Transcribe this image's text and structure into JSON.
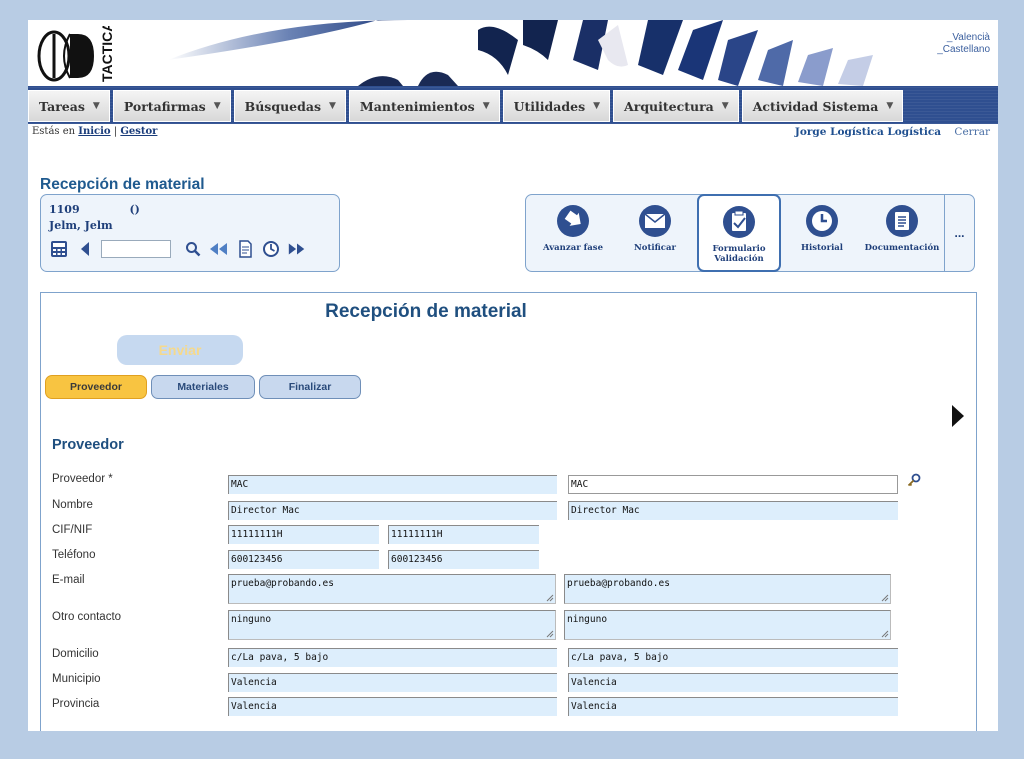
{
  "header": {
    "logo_text": "TACTICA",
    "languages": [
      "_Valencià",
      "_Castellano"
    ]
  },
  "menu": {
    "items": [
      {
        "label": "Tareas"
      },
      {
        "label": "Portafirmas"
      },
      {
        "label": "Búsquedas"
      },
      {
        "label": "Mantenimientos"
      },
      {
        "label": "Utilidades"
      },
      {
        "label": "Arquitectura"
      },
      {
        "label": "Actividad Sistema"
      }
    ]
  },
  "breadcrumb": {
    "prefix": "Estás en",
    "items": [
      "Inicio",
      "Gestor"
    ],
    "separator": "|"
  },
  "user": {
    "name": "Jorge Logística Logística",
    "logout": "Cerrar"
  },
  "record": {
    "title": "Recepción de material",
    "id": "1109",
    "paren": "()",
    "names": "Jelm, Jelm",
    "nav_input": ""
  },
  "actions": [
    {
      "label": "Avanzar fase",
      "icon": "advance-phase-icon"
    },
    {
      "label": "Notificar",
      "icon": "notify-icon"
    },
    {
      "label": "Formulario Validación",
      "icon": "validation-form-icon",
      "selected": true
    },
    {
      "label": "Historial",
      "icon": "history-icon"
    },
    {
      "label": "Documentación",
      "icon": "documentation-icon"
    }
  ],
  "actions_more": "...",
  "form": {
    "title": "Recepción de material",
    "submit_label": "Enviar",
    "tabs": [
      {
        "label": "Proveedor",
        "active": true
      },
      {
        "label": "Materiales",
        "active": false
      },
      {
        "label": "Finalizar",
        "active": false
      }
    ],
    "section_title": "Proveedor",
    "fields": {
      "proveedor": {
        "label": "Proveedor *",
        "value1": "MAC",
        "value2": "MAC"
      },
      "nombre": {
        "label": "Nombre",
        "value1": "Director Mac",
        "value2": "Director Mac"
      },
      "cif": {
        "label": "CIF/NIF",
        "value1": "11111111H",
        "value2": "11111111H"
      },
      "telefono": {
        "label": "Teléfono",
        "value1": "600123456",
        "value2": "600123456"
      },
      "email": {
        "label": "E-mail",
        "value1": "prueba@probando.es",
        "value2": "prueba@probando.es"
      },
      "otro": {
        "label": "Otro contacto",
        "value1": "ninguno",
        "value2": "ninguno"
      },
      "domicilio": {
        "label": "Domicilio",
        "value1": "c/La pava, 5 bajo",
        "value2": "c/La pava, 5 bajo"
      },
      "municipio": {
        "label": "Municipio",
        "value1": "Valencia",
        "value2": "Valencia"
      },
      "provincia": {
        "label": "Provincia",
        "value1": "Valencia",
        "value2": "Valencia"
      }
    }
  },
  "colors": {
    "background": "#b8cce4",
    "menubar": "#2f4f90",
    "title_blue": "#1f4f7f",
    "active_tab": "#f8c441",
    "field_bg": "#ddeefc"
  }
}
